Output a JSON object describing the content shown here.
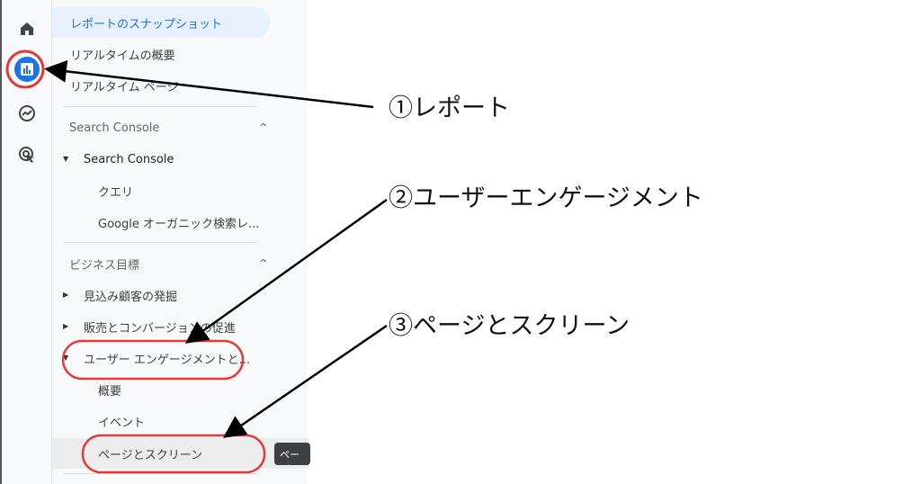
{
  "rail": {
    "icons": [
      "home-icon",
      "reports-icon",
      "explore-icon",
      "advertising-icon"
    ],
    "active": "reports-icon"
  },
  "nav": {
    "items": {
      "snapshot": "レポートのスナップショット",
      "realtime_overview": "リアルタイムの概要",
      "realtime_pages": "リアルタイム ページ",
      "sc_header": "Search Console",
      "sc_group": "Search Console",
      "queries": "クエリ",
      "organic": "Google オーガニック検索レ...",
      "biz_header": "ビジネス目標",
      "leads": "見込み顧客の発掘",
      "sales": "販売とコンバージョンの促進",
      "engagement": "ユーザー エンゲージメントと...",
      "overview": "概要",
      "events": "イベント",
      "pages": "ページとスクリーン"
    },
    "tooltip": "ページ"
  },
  "annotations": {
    "a1": "①レポート",
    "a2": "②ユーザーエンゲージメント",
    "a3": "③ページとスクリーン"
  },
  "colors": {
    "highlight": "#e53935",
    "accent": "#1a73e8"
  }
}
